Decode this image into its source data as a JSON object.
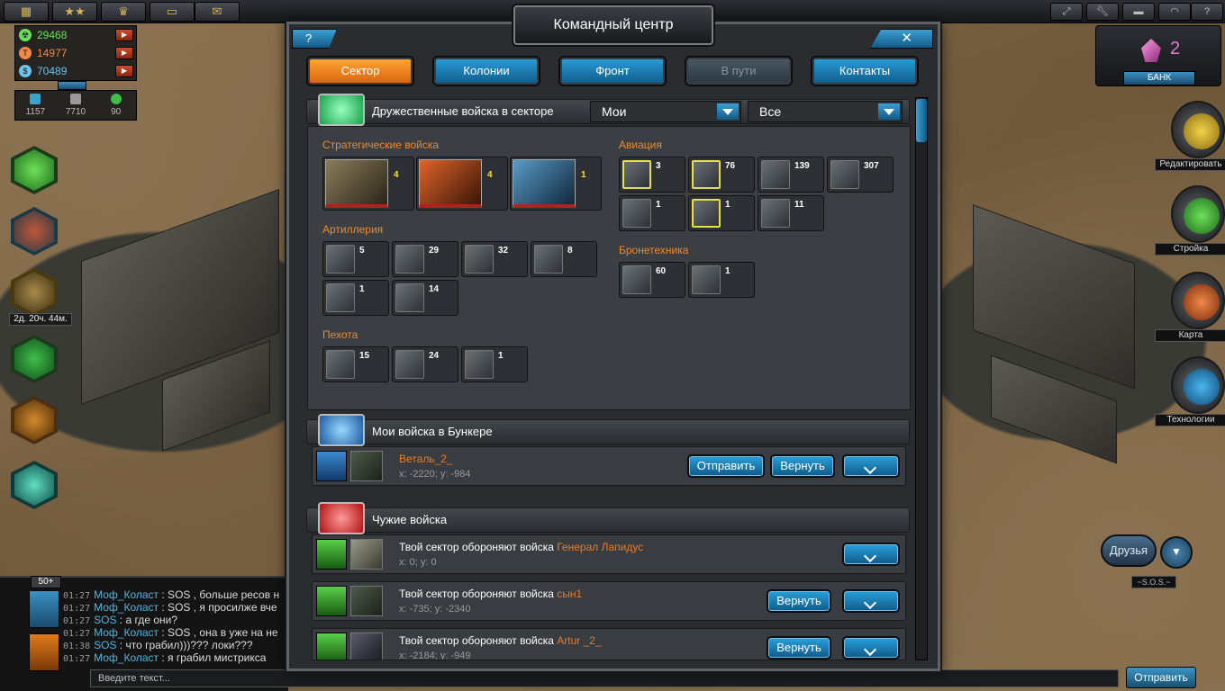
{
  "resources": [
    {
      "name": "resource-1",
      "value": "29468",
      "color": "#6be05a"
    },
    {
      "name": "resource-2",
      "value": "14977",
      "color": "#f0894a"
    },
    {
      "name": "resource-3",
      "value": "70489",
      "color": "#6ec3ee"
    }
  ],
  "population": {
    "a": "1157",
    "b": "7710",
    "c": "90"
  },
  "timer": "2д. 20ч. 44м.",
  "bank": {
    "value": "2",
    "label": "БАНК"
  },
  "side_menu": {
    "edit": "Редактировать",
    "build": "Стройка",
    "map": "Карта",
    "tech": "Технологии"
  },
  "friends": {
    "label": "Друзья",
    "sos": "~S.O.S.~"
  },
  "modal": {
    "title": "Командный центр",
    "help": "?",
    "close": "✕",
    "tabs": [
      "Сектор",
      "Колонии",
      "Фронт",
      "В пути",
      "Контакты"
    ],
    "friendly": {
      "title": "Дружественные войска в секторе",
      "filter1": "Мои",
      "filter2": "Все",
      "groups": {
        "strategic": "Стратегические войска",
        "aviation": "Авиация",
        "artillery": "Артиллерия",
        "armor": "Бронетехника",
        "infantry": "Пехота"
      },
      "strategic_units": [
        "4",
        "4",
        "1"
      ],
      "aviation_units": [
        "3",
        "76",
        "139",
        "307",
        "1",
        "1",
        "11"
      ],
      "artillery_units": [
        "5",
        "29",
        "32",
        "8",
        "1",
        "14"
      ],
      "armor_units": [
        "60",
        "1"
      ],
      "infantry_units": [
        "15",
        "24",
        "1"
      ]
    },
    "bunker": {
      "title": "Мои войска в Бункере",
      "player": "Веталь_2_",
      "coords": "x: -2220; y: -984",
      "send": "Отправить",
      "return": "Вернуть"
    },
    "foreign": {
      "title": "Чужие войска",
      "rows": [
        {
          "text": "Твой сектор обороняют войска",
          "who": "Генерал Лапидус",
          "coords": "x: 0; y: 0",
          "return": ""
        },
        {
          "text": "Твой сектор обороняют войска",
          "who": "сын1",
          "coords": "x: -735; y: -2340",
          "return": "Вернуть"
        },
        {
          "text": "Твой сектор обороняют войска",
          "who": "Artur _2_",
          "coords": "x: -2184; y: -949",
          "return": "Вернуть"
        }
      ]
    }
  },
  "chat": {
    "badge": "50+",
    "lines": [
      {
        "time": "01:27",
        "name": "Моф_Коласт",
        "msg": ": SOS , больше ресов н"
      },
      {
        "time": "01:27",
        "name": "Моф_Коласт",
        "msg": ": SOS , я просилже вче"
      },
      {
        "time": "01:27",
        "name": "SOS",
        "msg": ": а где они?"
      },
      {
        "time": "01:27",
        "name": "Моф_Коласт",
        "msg": ": SOS , она в уже на не"
      },
      {
        "time": "01:38",
        "name": "SOS",
        "msg": ": что грабил)))??? локи???"
      },
      {
        "time": "01:27",
        "name": "Моф_Коласт",
        "msg": ": я грабил мистрикса"
      }
    ],
    "placeholder": "Введите текст...",
    "send": "Отправить"
  }
}
